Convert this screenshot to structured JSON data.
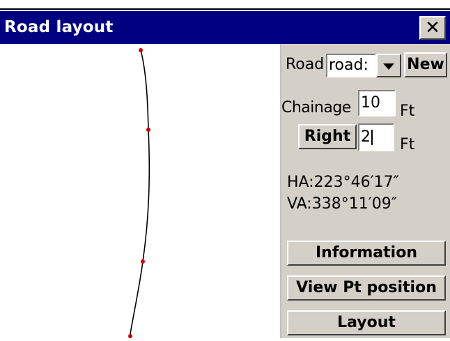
{
  "window": {
    "title": "Road layout"
  },
  "panel": {
    "road_label": "Road",
    "road_value": "road:",
    "new_button": "New",
    "chainage_label": "Chainage",
    "chainage_value": "10",
    "chainage_unit": "Ft",
    "offset_side_button": "Right",
    "offset_value": "2",
    "offset_unit": "Ft",
    "ha_readout": "HA:223°46′17″",
    "va_readout": "VA:338°11′09″",
    "information_button": "Information",
    "view_position_button": "View Pt position",
    "layout_button": "Layout"
  },
  "colors": {
    "title_bar": "#000080",
    "panel": "#d4d0c8",
    "point": "#cc0000",
    "line": "#000000"
  },
  "icons": {
    "close": "close-icon",
    "dropdown": "chevron-down-icon"
  }
}
